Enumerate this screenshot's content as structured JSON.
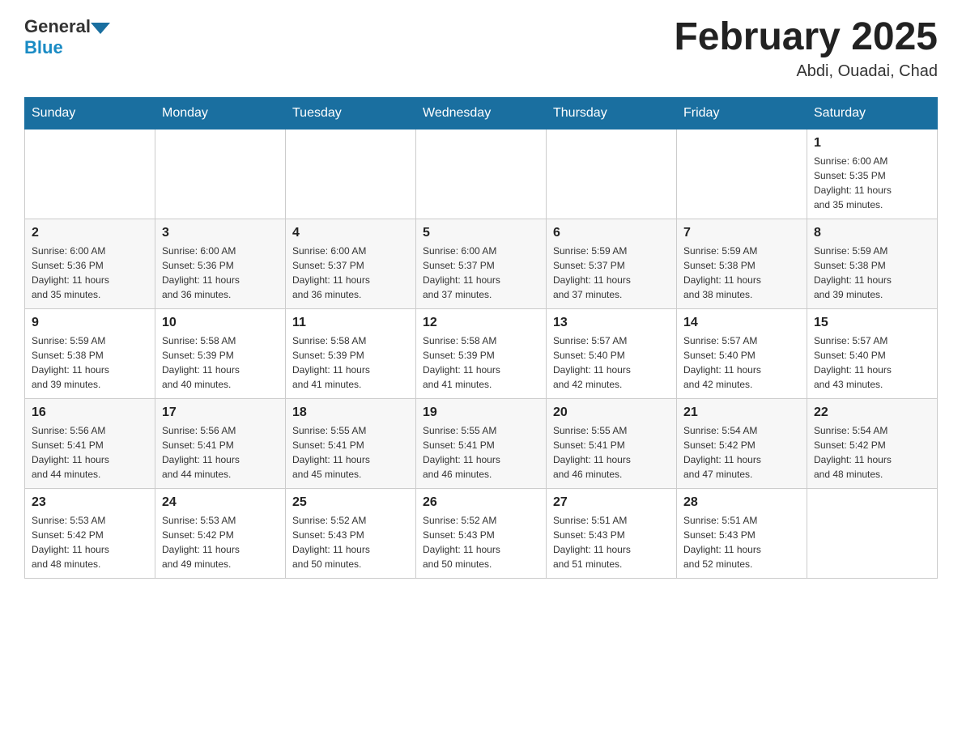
{
  "header": {
    "logo": {
      "general": "General",
      "blue": "Blue"
    },
    "title": "February 2025",
    "subtitle": "Abdi, Ouadai, Chad"
  },
  "weekdays": [
    "Sunday",
    "Monday",
    "Tuesday",
    "Wednesday",
    "Thursday",
    "Friday",
    "Saturday"
  ],
  "weeks": [
    {
      "days": [
        {
          "num": "",
          "info": ""
        },
        {
          "num": "",
          "info": ""
        },
        {
          "num": "",
          "info": ""
        },
        {
          "num": "",
          "info": ""
        },
        {
          "num": "",
          "info": ""
        },
        {
          "num": "",
          "info": ""
        },
        {
          "num": "1",
          "info": "Sunrise: 6:00 AM\nSunset: 5:35 PM\nDaylight: 11 hours\nand 35 minutes."
        }
      ]
    },
    {
      "days": [
        {
          "num": "2",
          "info": "Sunrise: 6:00 AM\nSunset: 5:36 PM\nDaylight: 11 hours\nand 35 minutes."
        },
        {
          "num": "3",
          "info": "Sunrise: 6:00 AM\nSunset: 5:36 PM\nDaylight: 11 hours\nand 36 minutes."
        },
        {
          "num": "4",
          "info": "Sunrise: 6:00 AM\nSunset: 5:37 PM\nDaylight: 11 hours\nand 36 minutes."
        },
        {
          "num": "5",
          "info": "Sunrise: 6:00 AM\nSunset: 5:37 PM\nDaylight: 11 hours\nand 37 minutes."
        },
        {
          "num": "6",
          "info": "Sunrise: 5:59 AM\nSunset: 5:37 PM\nDaylight: 11 hours\nand 37 minutes."
        },
        {
          "num": "7",
          "info": "Sunrise: 5:59 AM\nSunset: 5:38 PM\nDaylight: 11 hours\nand 38 minutes."
        },
        {
          "num": "8",
          "info": "Sunrise: 5:59 AM\nSunset: 5:38 PM\nDaylight: 11 hours\nand 39 minutes."
        }
      ]
    },
    {
      "days": [
        {
          "num": "9",
          "info": "Sunrise: 5:59 AM\nSunset: 5:38 PM\nDaylight: 11 hours\nand 39 minutes."
        },
        {
          "num": "10",
          "info": "Sunrise: 5:58 AM\nSunset: 5:39 PM\nDaylight: 11 hours\nand 40 minutes."
        },
        {
          "num": "11",
          "info": "Sunrise: 5:58 AM\nSunset: 5:39 PM\nDaylight: 11 hours\nand 41 minutes."
        },
        {
          "num": "12",
          "info": "Sunrise: 5:58 AM\nSunset: 5:39 PM\nDaylight: 11 hours\nand 41 minutes."
        },
        {
          "num": "13",
          "info": "Sunrise: 5:57 AM\nSunset: 5:40 PM\nDaylight: 11 hours\nand 42 minutes."
        },
        {
          "num": "14",
          "info": "Sunrise: 5:57 AM\nSunset: 5:40 PM\nDaylight: 11 hours\nand 42 minutes."
        },
        {
          "num": "15",
          "info": "Sunrise: 5:57 AM\nSunset: 5:40 PM\nDaylight: 11 hours\nand 43 minutes."
        }
      ]
    },
    {
      "days": [
        {
          "num": "16",
          "info": "Sunrise: 5:56 AM\nSunset: 5:41 PM\nDaylight: 11 hours\nand 44 minutes."
        },
        {
          "num": "17",
          "info": "Sunrise: 5:56 AM\nSunset: 5:41 PM\nDaylight: 11 hours\nand 44 minutes."
        },
        {
          "num": "18",
          "info": "Sunrise: 5:55 AM\nSunset: 5:41 PM\nDaylight: 11 hours\nand 45 minutes."
        },
        {
          "num": "19",
          "info": "Sunrise: 5:55 AM\nSunset: 5:41 PM\nDaylight: 11 hours\nand 46 minutes."
        },
        {
          "num": "20",
          "info": "Sunrise: 5:55 AM\nSunset: 5:41 PM\nDaylight: 11 hours\nand 46 minutes."
        },
        {
          "num": "21",
          "info": "Sunrise: 5:54 AM\nSunset: 5:42 PM\nDaylight: 11 hours\nand 47 minutes."
        },
        {
          "num": "22",
          "info": "Sunrise: 5:54 AM\nSunset: 5:42 PM\nDaylight: 11 hours\nand 48 minutes."
        }
      ]
    },
    {
      "days": [
        {
          "num": "23",
          "info": "Sunrise: 5:53 AM\nSunset: 5:42 PM\nDaylight: 11 hours\nand 48 minutes."
        },
        {
          "num": "24",
          "info": "Sunrise: 5:53 AM\nSunset: 5:42 PM\nDaylight: 11 hours\nand 49 minutes."
        },
        {
          "num": "25",
          "info": "Sunrise: 5:52 AM\nSunset: 5:43 PM\nDaylight: 11 hours\nand 50 minutes."
        },
        {
          "num": "26",
          "info": "Sunrise: 5:52 AM\nSunset: 5:43 PM\nDaylight: 11 hours\nand 50 minutes."
        },
        {
          "num": "27",
          "info": "Sunrise: 5:51 AM\nSunset: 5:43 PM\nDaylight: 11 hours\nand 51 minutes."
        },
        {
          "num": "28",
          "info": "Sunrise: 5:51 AM\nSunset: 5:43 PM\nDaylight: 11 hours\nand 52 minutes."
        },
        {
          "num": "",
          "info": ""
        }
      ]
    }
  ]
}
